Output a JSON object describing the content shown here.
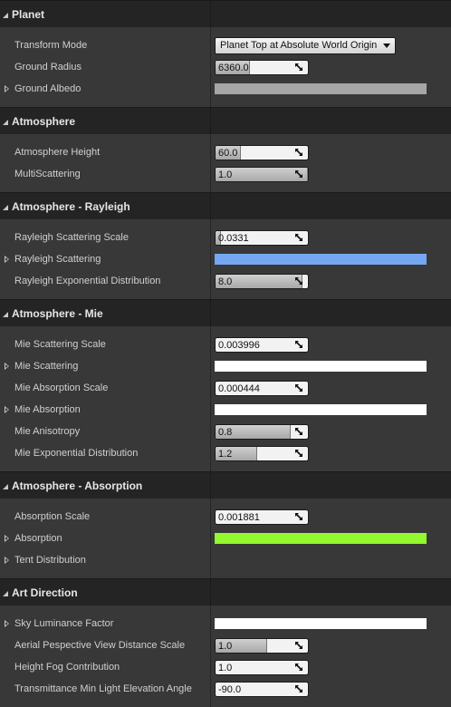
{
  "sections": [
    {
      "title": "Planet",
      "rows": [
        {
          "label": "Transform Mode",
          "type": "dropdown",
          "value": "Planet Top at Absolute World Origin",
          "expandable": false
        },
        {
          "label": "Ground Radius",
          "type": "number",
          "value": "6360.0",
          "fill": 0.36,
          "expandable": false
        },
        {
          "label": "Ground Albedo",
          "type": "color",
          "color": "#a6a6a6",
          "expandable": true
        }
      ]
    },
    {
      "title": "Atmosphere",
      "rows": [
        {
          "label": "Atmosphere Height",
          "type": "number",
          "value": "60.0",
          "fill": 0.26,
          "expandable": false
        },
        {
          "label": "MultiScattering",
          "type": "number",
          "value": "1.0",
          "fill": 0.99,
          "expandable": false
        }
      ]
    },
    {
      "title": "Atmosphere - Rayleigh",
      "rows": [
        {
          "label": "Rayleigh Scattering Scale",
          "type": "number",
          "value": "0.0331",
          "fill": 0.05,
          "expandable": false
        },
        {
          "label": "Rayleigh Scattering",
          "type": "color",
          "color": "#75a7f2",
          "expandable": true
        },
        {
          "label": "Rayleigh Exponential Distribution",
          "type": "number",
          "value": "8.0",
          "fill": 0.93,
          "expandable": false
        }
      ]
    },
    {
      "title": "Atmosphere - Mie",
      "rows": [
        {
          "label": "Mie Scattering Scale",
          "type": "number",
          "value": "0.003996",
          "fill": 0.0,
          "expandable": false
        },
        {
          "label": "Mie Scattering",
          "type": "color",
          "color": "#ffffff",
          "expandable": true
        },
        {
          "label": "Mie Absorption Scale",
          "type": "number",
          "value": "0.000444",
          "fill": 0.0,
          "expandable": false
        },
        {
          "label": "Mie Absorption",
          "type": "color",
          "color": "#ffffff",
          "expandable": true
        },
        {
          "label": "Mie Anisotropy",
          "type": "number",
          "value": "0.8",
          "fill": 0.8,
          "expandable": false
        },
        {
          "label": "Mie Exponential Distribution",
          "type": "number",
          "value": "1.2",
          "fill": 0.44,
          "expandable": false
        }
      ]
    },
    {
      "title": "Atmosphere - Absorption",
      "rows": [
        {
          "label": "Absorption Scale",
          "type": "number",
          "value": "0.001881",
          "fill": 0.0,
          "expandable": false
        },
        {
          "label": "Absorption",
          "type": "color",
          "color": "#94f82f",
          "expandable": true
        },
        {
          "label": "Tent Distribution",
          "type": "none",
          "expandable": true
        }
      ]
    },
    {
      "title": "Art Direction",
      "rows": [
        {
          "label": "Sky Luminance Factor",
          "type": "color",
          "color": "#ffffff",
          "expandable": true
        },
        {
          "label": "Aerial Pespective View Distance Scale",
          "type": "number",
          "value": "1.0",
          "fill": 0.55,
          "expandable": false
        },
        {
          "label": "Height Fog Contribution",
          "type": "number",
          "value": "1.0",
          "fill": 0.0,
          "expandable": false
        },
        {
          "label": "Transmittance Min Light Elevation Angle",
          "type": "number",
          "value": "-90.0",
          "fill": 0.0,
          "expandable": false
        }
      ]
    }
  ]
}
